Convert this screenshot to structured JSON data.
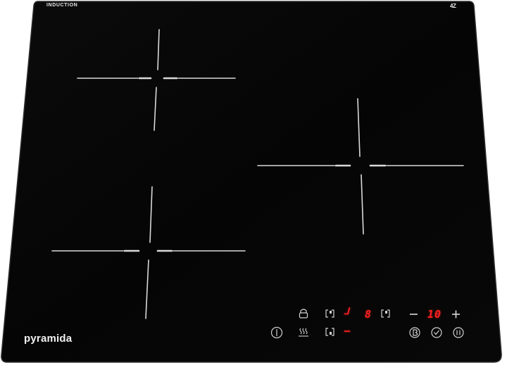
{
  "header": {
    "induction_label": "INDUCTION",
    "badge_label": "4Z"
  },
  "branding": {
    "name": "pyramida"
  },
  "control_panel": {
    "zone_display": "ᒧ",
    "level_display": "8",
    "timer_display": "10",
    "secondary_display": "–",
    "minus_symbol": "–",
    "plus_symbol": "+"
  },
  "colors": {
    "glass": "#050505",
    "glass_edge": "#2c2c2c",
    "zone_marks": "#d9d9d9",
    "display_red": "#ff1f1f",
    "text": "#e8e8e8"
  },
  "icons": {
    "power": "power-icon",
    "lock": "lock-icon",
    "keep_warm": "keep-warm-icon",
    "zone_select": "zone-select-icon",
    "booster": "booster-icon",
    "timer": "timer-icon",
    "pause": "pause-icon"
  }
}
